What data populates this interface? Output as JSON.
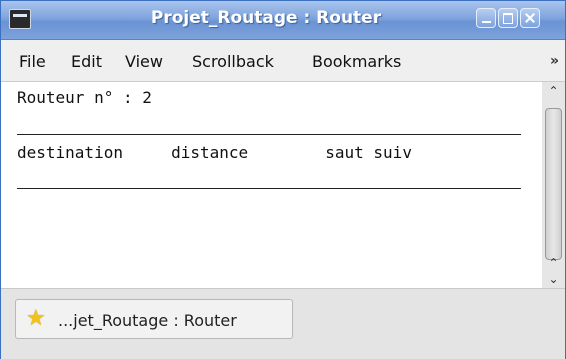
{
  "window": {
    "title": "Projet_Routage : Router"
  },
  "menu": {
    "items": [
      "File",
      "Edit",
      "View",
      "Scrollback",
      "Bookmarks"
    ],
    "overflow": "»"
  },
  "terminal": {
    "lines": [
      "Routeur n° : 2",
      "destination     distance        saut suiv"
    ]
  },
  "tab": {
    "label": "...jet_Routage : Router",
    "icon": "star-icon"
  },
  "colors": {
    "titlebar_accent": "#6a93d4",
    "tab_icon": "#f0c21b"
  }
}
